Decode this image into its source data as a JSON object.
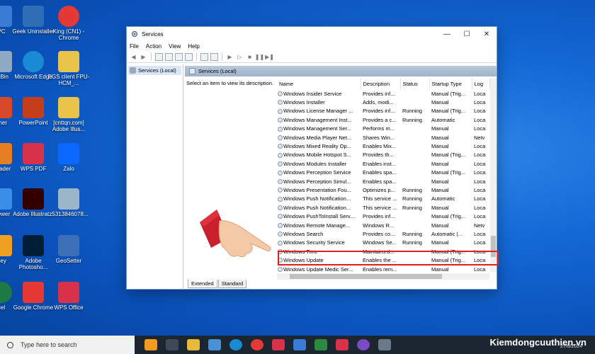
{
  "desktop_icons": [
    {
      "label": "PC",
      "color": "#3a7bd5"
    },
    {
      "label": "Geek Uninstaller",
      "color": "#2f6db5"
    },
    {
      "label": "King (CN1) - Chrome",
      "color": "#e53935"
    },
    {
      "label": "le Bin",
      "color": "#8fa9c4"
    },
    {
      "label": "Microsoft Edge",
      "color": "#1a8ad4"
    },
    {
      "label": "EGS client FPU-HCM_...",
      "color": "#e8c44a"
    },
    {
      "label": "aner",
      "color": "#d8492a"
    },
    {
      "label": "PowerPoint",
      "color": "#c43e1c"
    },
    {
      "label": "[cnttqn.com] Adobe Illus...",
      "color": "#e8c44a"
    },
    {
      "label": "Reader",
      "color": "#e67e22"
    },
    {
      "label": "WPS PDF",
      "color": "#d8324a"
    },
    {
      "label": "Zalo",
      "color": "#0a68ff"
    },
    {
      "label": "Viewer",
      "color": "#3a8ee6"
    },
    {
      "label": "Adobe Illustrat...",
      "color": "#330000"
    },
    {
      "label": "z5313846078...",
      "color": "#9bb5c9"
    },
    {
      "label": "Key",
      "color": "#f0a020"
    },
    {
      "label": "Adobe Photosho...",
      "color": "#001e36"
    },
    {
      "label": "GeoSetter",
      "color": "#3b6fb6"
    },
    {
      "label": "cel",
      "color": "#1d7a45"
    },
    {
      "label": "Google Chrome",
      "color": "#e53935"
    },
    {
      "label": "WPS Office",
      "color": "#d8324a"
    }
  ],
  "window": {
    "title": "Services",
    "menu": [
      "File",
      "Action",
      "View",
      "Help"
    ],
    "tree_item": "Services (Local)",
    "pane_header": "Services (Local)",
    "description_prompt": "Select an item to view its description.",
    "columns": [
      "Name",
      "Description",
      "Status",
      "Startup Type",
      "Log"
    ],
    "rows": [
      [
        "Windows Insider Service",
        "Provides inf...",
        "",
        "Manual (Trig...",
        "Loca"
      ],
      [
        "Windows Installer",
        "Adds, modi...",
        "",
        "Manual",
        "Loca"
      ],
      [
        "Windows License Manager ...",
        "Provides inf...",
        "Running",
        "Manual (Trig...",
        "Loca"
      ],
      [
        "Windows Management Inst...",
        "Provides a c...",
        "Running",
        "Automatic",
        "Loca"
      ],
      [
        "Windows Management Ser...",
        "Performs m...",
        "",
        "Manual",
        "Loca"
      ],
      [
        "Windows Media Player Net...",
        "Shares Win...",
        "",
        "Manual",
        "Netv"
      ],
      [
        "Windows Mixed Reality Op...",
        "Enables Mix...",
        "",
        "Manual",
        "Loca"
      ],
      [
        "Windows Mobile Hotspot S...",
        "Provides th...",
        "",
        "Manual (Trig...",
        "Loca"
      ],
      [
        "Windows Modules Installer",
        "Enables inst...",
        "",
        "Manual",
        "Loca"
      ],
      [
        "Windows Perception Service",
        "Enables spa...",
        "",
        "Manual (Trig...",
        "Loca"
      ],
      [
        "Windows Perception Simul...",
        "Enables spa...",
        "",
        "Manual",
        "Loca"
      ],
      [
        "Windows Presentation Fou...",
        "Optimizes p...",
        "Running",
        "Manual",
        "Loca"
      ],
      [
        "Windows Push Notification...",
        "This service ...",
        "Running",
        "Automatic",
        "Loca"
      ],
      [
        "Windows Push Notification...",
        "This service ...",
        "Running",
        "Manual",
        "Loca"
      ],
      [
        "Windows PushToInstall Serv...",
        "Provides inf...",
        "",
        "Manual (Trig...",
        "Loca"
      ],
      [
        "Windows Remote Manage...",
        "Windows R...",
        "",
        "Manual",
        "Netv"
      ],
      [
        "Windows Search",
        "Provides co...",
        "Running",
        "Automatic (...",
        "Loca"
      ],
      [
        "Windows Security Service",
        "Windows Se...",
        "Running",
        "Manual",
        "Loca"
      ],
      [
        "Windows Time",
        "Maintains d...",
        "",
        "Manual (Trig...",
        "Loca"
      ],
      [
        "Windows Update",
        "Enables the ...",
        "",
        "Manual (Trig...",
        "Loca"
      ],
      [
        "Windows Update Medic Ser...",
        "Enables rem...",
        "",
        "Manual",
        "Loca"
      ]
    ],
    "tabs": [
      "Extended",
      "Standard"
    ]
  },
  "taskbar": {
    "search_placeholder": "Type here to search",
    "brand": "Kiemdongcuuthien.vn",
    "date": "27/6/2024"
  },
  "colors": {
    "highlight": "#e02020",
    "accent": "#1469d6"
  }
}
